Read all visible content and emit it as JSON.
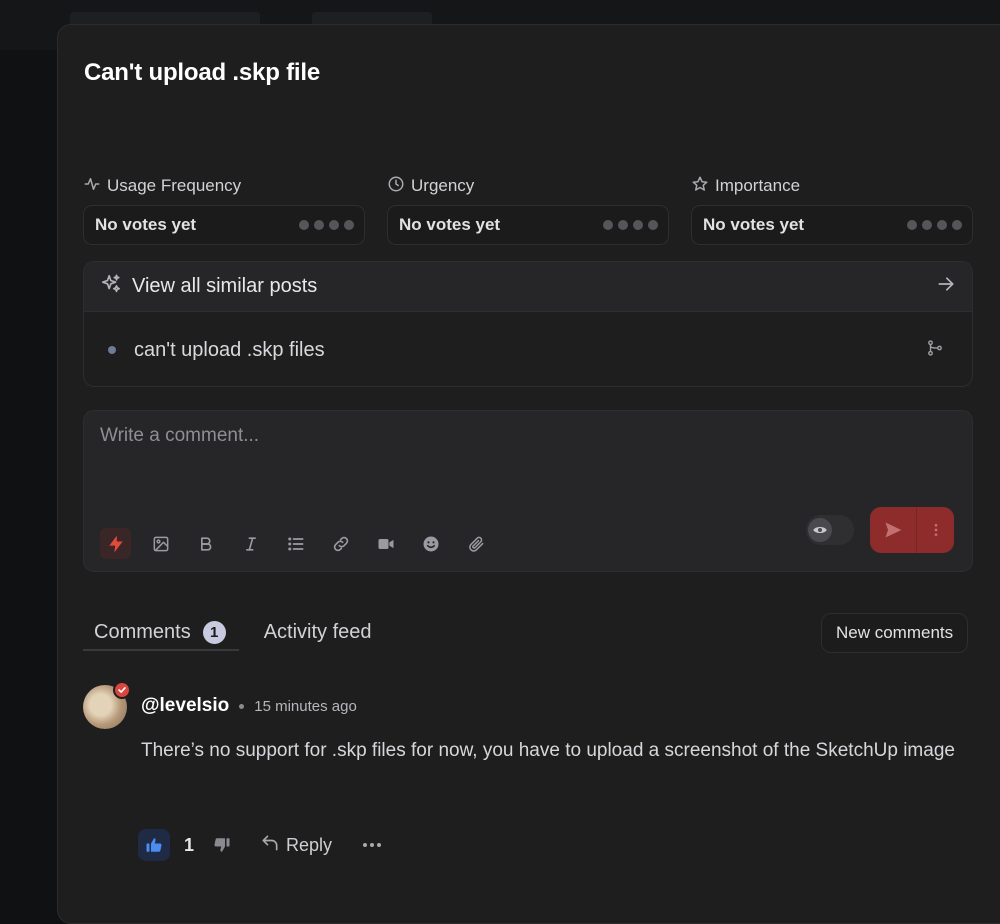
{
  "post": {
    "title": "Can't upload .skp file"
  },
  "metrics": [
    {
      "label": "Usage Frequency",
      "icon": "activity-icon",
      "value": "No votes yet"
    },
    {
      "label": "Urgency",
      "icon": "clock-icon",
      "value": "No votes yet"
    },
    {
      "label": "Importance",
      "icon": "star-icon",
      "value": "No votes yet"
    }
  ],
  "similar": {
    "title": "View all similar posts",
    "items": [
      {
        "label": "can't upload .skp files"
      }
    ]
  },
  "composer": {
    "placeholder": "Write a comment...",
    "toolbar": [
      "lightning-icon",
      "image-icon",
      "bold-icon",
      "italic-icon",
      "list-icon",
      "link-icon",
      "video-icon",
      "emoji-icon",
      "attachment-icon"
    ]
  },
  "tabs": {
    "comments_label": "Comments",
    "comments_count": "1",
    "activity_label": "Activity feed",
    "new_comments_label": "New comments"
  },
  "comment": {
    "user": "@levelsio",
    "time": "15 minutes ago",
    "body": "There’s no support for .skp files for now, you have to upload a screenshot of the SketchUp image",
    "likes": "1",
    "reply_label": "Reply"
  },
  "colors": {
    "accent_send": "#8e2c2c",
    "active_tool": "#e24a3b",
    "like_blue": "#4a8cf0",
    "badge": "#d9463e"
  }
}
